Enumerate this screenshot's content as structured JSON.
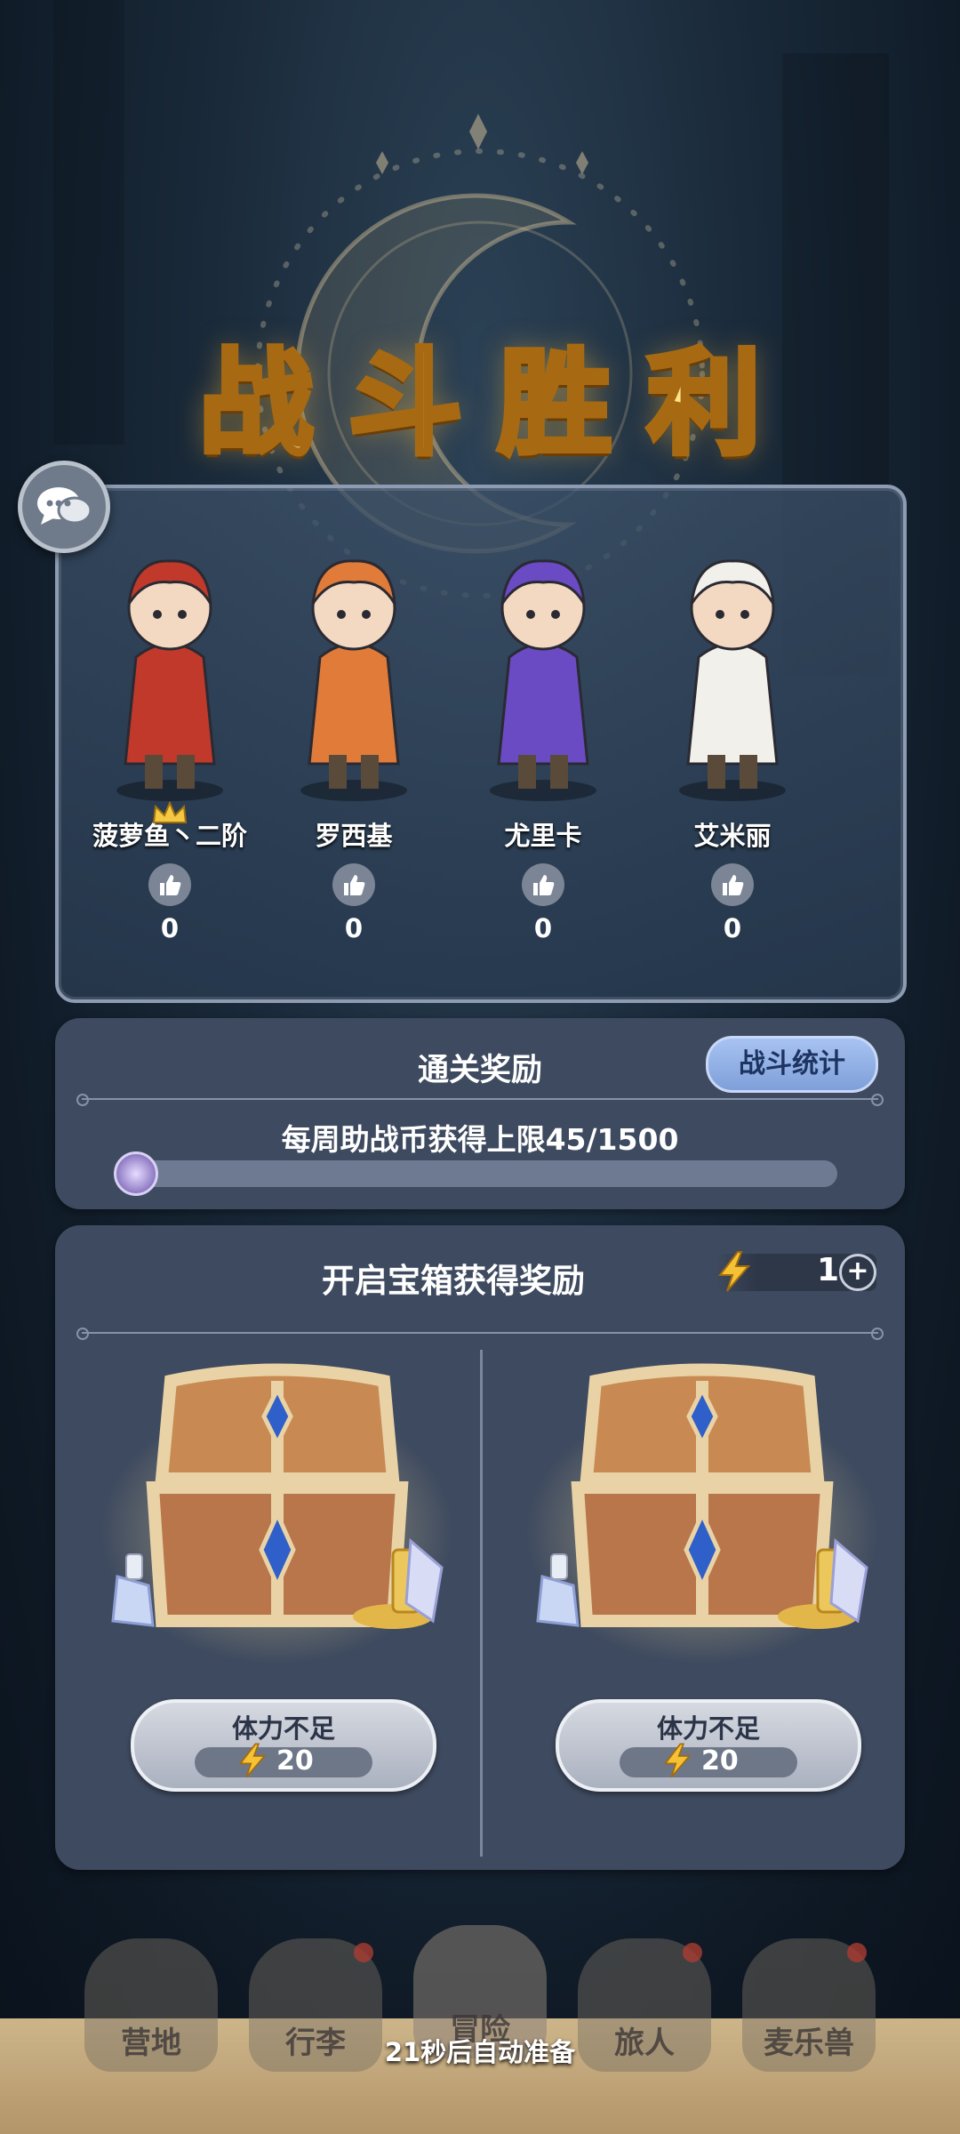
{
  "banner": {
    "title": "战斗胜利"
  },
  "chat": {
    "icon": "chat-bubbles-icon"
  },
  "team": [
    {
      "name": "菠萝鱼丶二阶",
      "likes": "0",
      "leader": true,
      "color": "#c0392b"
    },
    {
      "name": "罗西基",
      "likes": "0",
      "leader": false,
      "color": "#e07b39"
    },
    {
      "name": "尤里卡",
      "likes": "0",
      "leader": false,
      "color": "#6a4bc4"
    },
    {
      "name": "艾米丽",
      "likes": "0",
      "leader": false,
      "color": "#f2f0ea"
    }
  ],
  "clear_reward": {
    "title": "通关奖励",
    "stats_button": "战斗统计",
    "coin_limit_text": "每周助战币获得上限45/1500",
    "progress": 0.03
  },
  "chest_reward": {
    "title": "开启宝箱获得奖励",
    "energy_count": "1",
    "plus_label": "+",
    "chests": [
      {
        "button_label": "体力不足",
        "cost": "20"
      },
      {
        "button_label": "体力不足",
        "cost": "20"
      }
    ]
  },
  "bottom_nav": {
    "items": [
      "营地",
      "行李",
      "冒险",
      "旅人",
      "麦乐兽"
    ],
    "auto_ready_text": "21秒后自动准备"
  }
}
